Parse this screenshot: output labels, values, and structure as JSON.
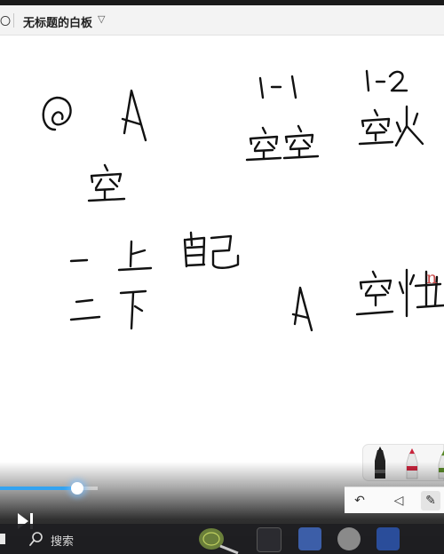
{
  "window": {
    "back_glyph": "〇",
    "title": "无标题的白板",
    "title_chevron": "▽"
  },
  "board": {
    "cut_off_text": "n"
  },
  "pen_tray": {
    "pens": [
      "black-pen",
      "red-pen",
      "green-pen"
    ]
  },
  "playback": {
    "progress_fraction": 0.17
  },
  "toolbar": {
    "undo_glyph": "↶",
    "select_glyph": "◁",
    "pen_glyph": "✎"
  },
  "taskbar": {
    "search_label": "搜索"
  },
  "colors": {
    "accent": "#33a3f0",
    "ink": "#111111",
    "red_text": "#c94a4a"
  }
}
